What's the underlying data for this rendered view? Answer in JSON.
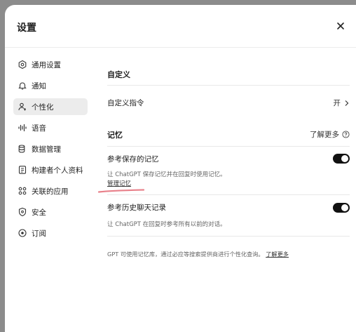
{
  "dialog": {
    "title": "设置"
  },
  "sidebar": {
    "items": [
      {
        "label": "通用设置",
        "icon": "gear-icon"
      },
      {
        "label": "通知",
        "icon": "bell-icon"
      },
      {
        "label": "个性化",
        "icon": "personalize-icon",
        "active": true
      },
      {
        "label": "语音",
        "icon": "waveform-icon"
      },
      {
        "label": "数据管理",
        "icon": "database-icon"
      },
      {
        "label": "构建者个人资料",
        "icon": "id-card-icon"
      },
      {
        "label": "关联的应用",
        "icon": "apps-grid-icon"
      },
      {
        "label": "安全",
        "icon": "shield-icon"
      },
      {
        "label": "订阅",
        "icon": "subscription-icon"
      }
    ]
  },
  "main": {
    "custom": {
      "title": "自定义",
      "instructions_label": "自定义指令",
      "instructions_value": "开"
    },
    "memory": {
      "title": "记忆",
      "learn_more": "了解更多",
      "saved": {
        "label": "参考保存的记忆",
        "desc": "让 ChatGPT 保存记忆并在回复时使用记忆。",
        "manage": "管理记忆",
        "enabled": true
      },
      "history": {
        "label": "参考历史聊天记录",
        "desc": "让 ChatGPT 在回复时参考所有以前的对话。",
        "enabled": true
      },
      "footer": {
        "text": "GPT 可使用记忆库，通过必应等搜索提供商进行个性化查询。",
        "link": "了解更多"
      }
    }
  },
  "colors": {
    "toggle_on": "#111111",
    "annotation": "#e8808a",
    "active_nav": "#ececec"
  }
}
